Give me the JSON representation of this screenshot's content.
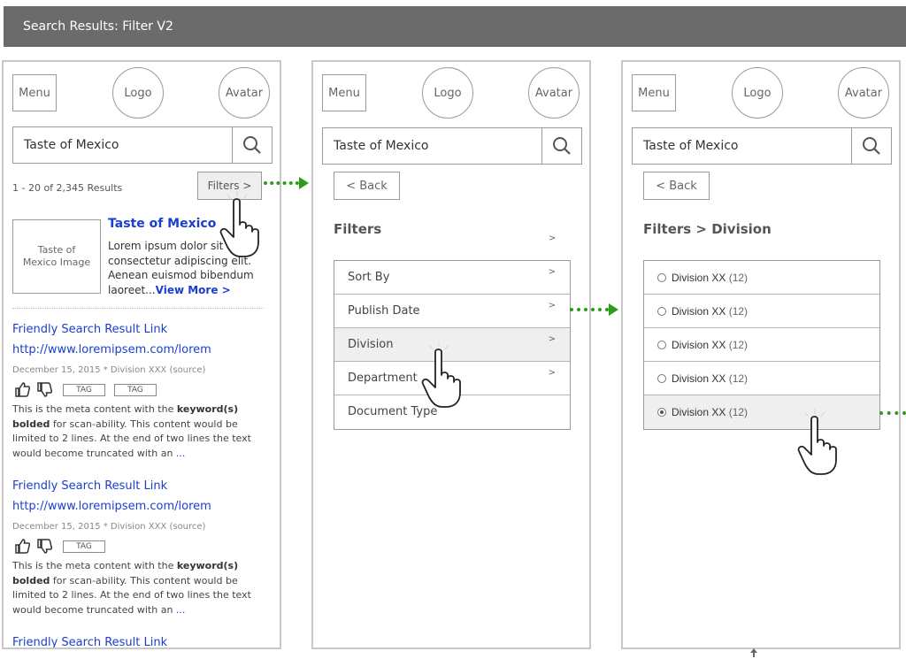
{
  "window": {
    "title": "Search Results: Filter V2"
  },
  "header": {
    "menu": "Menu",
    "logo": "Logo",
    "avatar": "Avatar"
  },
  "search": {
    "query": "Taste of Mexico"
  },
  "panel1": {
    "results_count": "1 - 20 of 2,345 Results",
    "filters_button": "Filters >",
    "featured": {
      "image_label": "Taste of Mexico Image",
      "title": "Taste of Mexico",
      "lines": [
        "Lorem ipsum dolor sit am",
        "consectetur adipiscing elit.",
        "Aenean euismod bibendum"
      ],
      "last_line": "laoreet...",
      "more_link": "View More >"
    },
    "results": [
      {
        "title": "Friendly Search Result Link",
        "url": "http://www.loremipsem.com/lorem",
        "meta": "December 15, 2015  *  Division XXX (source)",
        "tags": [
          "TAG",
          "TAG"
        ],
        "snippet_pre": "This is the meta content with the ",
        "snippet_bold": "keyword(s) bolded",
        "snippet_post": " for scan-ability. This content would be limited to 2 lines. At the end of two lines the text would become truncated with an ",
        "ellipsis": "..."
      },
      {
        "title": "Friendly Search Result Link",
        "url": "http://www.loremipsem.com/lorem",
        "meta": "December 15, 2015  *  Division XXX (source)",
        "tags": [
          "TAG"
        ],
        "snippet_pre": "This is the meta content with the ",
        "snippet_bold": "keyword(s) bolded",
        "snippet_post": " for scan-ability. This content would be limited to 2 lines. At the end of two lines the text would become truncated with an ",
        "ellipsis": "..."
      },
      {
        "title": "Friendly Search Result Link"
      }
    ]
  },
  "panel2": {
    "back": "< Back",
    "heading": "Filters",
    "heading_chevron": ">",
    "items": [
      {
        "label": "Sort By",
        "chevron": ">"
      },
      {
        "label": "Publish Date",
        "chevron": ">"
      },
      {
        "label": "Division",
        "chevron": ">"
      },
      {
        "label": "Department",
        "chevron": ">"
      },
      {
        "label": "Document Type"
      }
    ]
  },
  "panel3": {
    "back": "< Back",
    "heading": "Filters > Division",
    "options": [
      {
        "label": "Division XX",
        "count": "(12)",
        "selected": false
      },
      {
        "label": "Division XX",
        "count": "(12)",
        "selected": false
      },
      {
        "label": "Division XX",
        "count": "(12)",
        "selected": false
      },
      {
        "label": "Division XX",
        "count": "(12)",
        "selected": false
      },
      {
        "label": "Division XX",
        "count": "(12)",
        "selected": true
      }
    ]
  },
  "colors": {
    "link": "#1a3fcf",
    "arrow": "#2f9a1c",
    "titlebar": "#6b6b6b"
  },
  "icons": [
    "search-icon",
    "thumbs-up-icon",
    "thumbs-down-icon",
    "hand-pointer-icon",
    "flow-arrow-icon"
  ]
}
